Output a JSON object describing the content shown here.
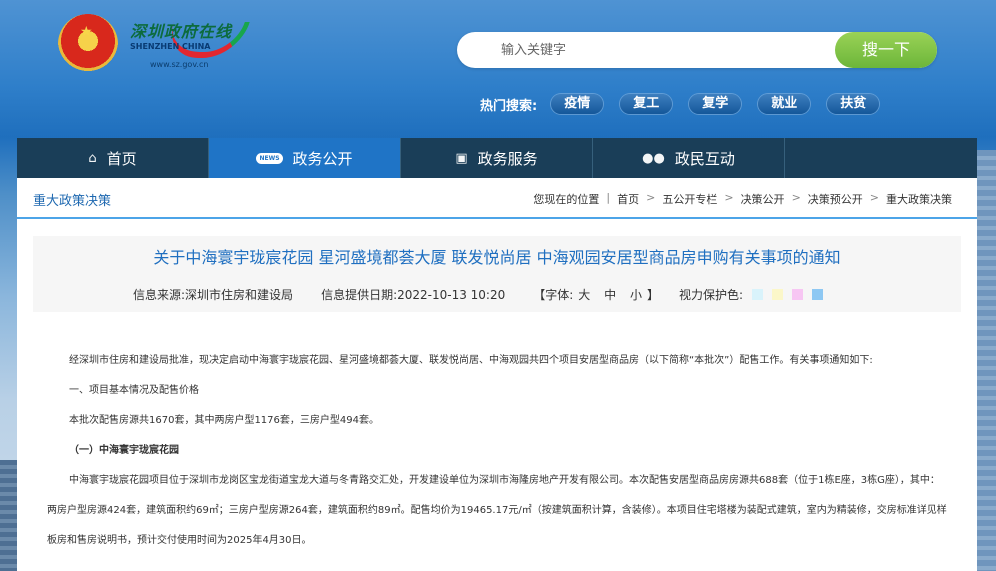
{
  "header": {
    "logo_cn": "深圳政府在线",
    "logo_en": "SHENZHEN CHINA",
    "logo_url": "www.sz.gov.cn"
  },
  "search": {
    "placeholder": "输入关键字",
    "button_label": "搜一下",
    "hot_label": "热门搜索:",
    "hot_tags": [
      "疫情",
      "复工",
      "复学",
      "就业",
      "扶贫"
    ]
  },
  "nav": [
    {
      "label": "首页",
      "icon": "home-icon"
    },
    {
      "label": "政务公开",
      "icon": "news-icon"
    },
    {
      "label": "政务服务",
      "icon": "monitor-icon"
    },
    {
      "label": "政民互动",
      "icon": "people-icon"
    }
  ],
  "breadcrumb": {
    "section_title": "重大政策决策",
    "location_label": "您现在的位置",
    "items": [
      "首页",
      "五公开专栏",
      "决策公开",
      "决策预公开",
      "重大政策决策"
    ]
  },
  "article": {
    "title": "关于中海寰宇珑宸花园 星河盛境都荟大厦 联发悦尚居 中海观园安居型商品房申购有关事项的通知",
    "source_label": "信息来源:",
    "source": "深圳市住房和建设局",
    "date_label": "信息提供日期:",
    "date": "2022-10-13 10:20",
    "font_label": "【字体:",
    "font_sizes": [
      "大",
      "中",
      "小"
    ],
    "font_close": "】",
    "vision_label": "视力保护色:",
    "vision_colors": [
      "#d9f3fb",
      "#fbf7c9",
      "#f7c6f3",
      "#8ec8f3"
    ],
    "paragraphs": [
      "经深圳市住房和建设局批准，现决定启动中海寰宇珑宸花园、星河盛境都荟大厦、联发悦尚居、中海观园共四个项目安居型商品房（以下简称“本批次”）配售工作。有关事项通知如下:",
      "一、项目基本情况及配售价格",
      "本批次配售房源共1670套，其中两房户型1176套，三房户型494套。",
      "（一）中海寰宇珑宸花园",
      "中海寰宇珑宸花园项目位于深圳市龙岗区宝龙街道宝龙大道与冬青路交汇处，开发建设单位为深圳市海隆房地产开发有限公司。本次配售安居型商品房房源共688套（位于1栋E座，3栋G座），其中：两房户型房源424套，建筑面积约69㎡；三房户型房源264套，建筑面积约89㎡。配售均价为19465.17元/㎡（按建筑面积计算，含装修）。本项目住宅塔楼为装配式建筑，室内为精装修，交房标准详见样板房和售房说明书，预计交付使用时间为2025年4月30日。"
    ]
  }
}
